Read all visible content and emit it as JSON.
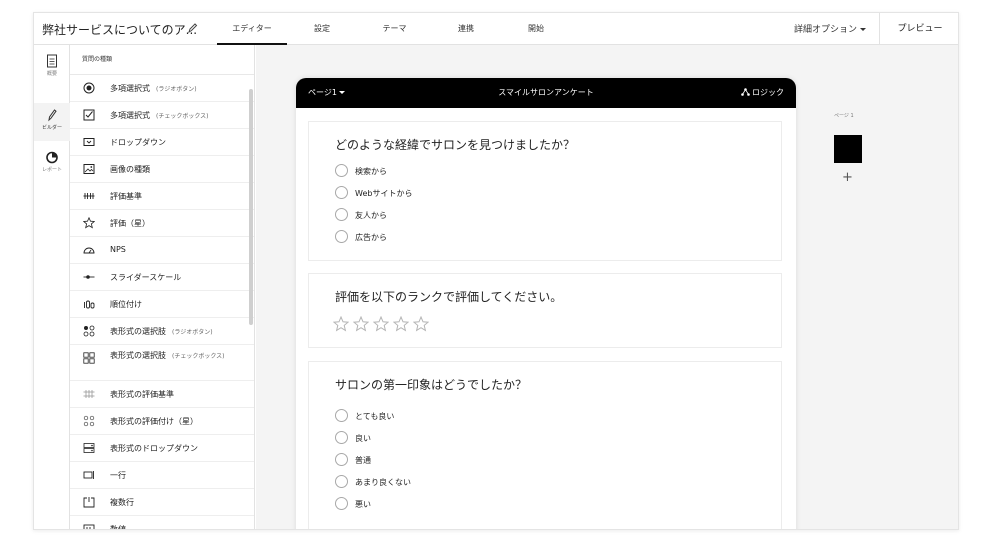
{
  "topbar": {
    "survey_title": "弊社サービスについてのア...",
    "tabs": [
      {
        "label": "エディター",
        "active": true
      },
      {
        "label": "設定",
        "active": false
      },
      {
        "label": "テーマ",
        "active": false
      },
      {
        "label": "連携",
        "active": false
      },
      {
        "label": "開始",
        "active": false
      }
    ],
    "advanced_options": "詳細オプション",
    "preview": "プレビュー"
  },
  "rail": [
    {
      "label": "概要",
      "icon": "document-icon"
    },
    {
      "label": "ビルダー",
      "icon": "pencil-icon",
      "active": true
    },
    {
      "label": "レポート",
      "icon": "pie-chart-icon"
    }
  ],
  "question_types": {
    "header": "質問の種類",
    "items": [
      {
        "label": "多項選択式",
        "sub": "(ラジオボタン)",
        "icon": "radio-button-icon"
      },
      {
        "label": "多項選択式",
        "sub": "(チェックボックス)",
        "icon": "checkbox-icon"
      },
      {
        "label": "ドロップダウン",
        "sub": "",
        "icon": "dropdown-icon"
      },
      {
        "label": "画像の種類",
        "sub": "",
        "icon": "image-icon"
      },
      {
        "label": "評価基準",
        "sub": "",
        "icon": "scale-icon"
      },
      {
        "label": "評価（星）",
        "sub": "",
        "icon": "star-icon"
      },
      {
        "label": "NPS",
        "sub": "",
        "icon": "gauge-icon"
      },
      {
        "label": "スライダースケール",
        "sub": "",
        "icon": "slider-icon"
      },
      {
        "label": "順位付け",
        "sub": "",
        "icon": "ranking-icon"
      },
      {
        "label": "表形式の選択肢",
        "sub": "(ラジオボタン)",
        "icon": "matrix-radio-icon"
      },
      {
        "label": "表形式の選択肢",
        "sub": "(チェックボックス)",
        "icon": "matrix-checkbox-icon"
      },
      {
        "label": "表形式の評価基準",
        "sub": "",
        "icon": "matrix-scale-icon"
      },
      {
        "label": "表形式の評価付け（星）",
        "sub": "",
        "icon": "matrix-star-icon"
      },
      {
        "label": "表形式のドロップダウン",
        "sub": "",
        "icon": "matrix-dropdown-icon"
      },
      {
        "label": "一行",
        "sub": "",
        "icon": "single-line-icon"
      },
      {
        "label": "複数行",
        "sub": "",
        "icon": "multi-line-icon"
      },
      {
        "label": "数値",
        "sub": "",
        "icon": "number-icon"
      }
    ]
  },
  "survey": {
    "page_label": "ページ1",
    "name": "スマイルサロンアンケート",
    "logic": "ロジック",
    "questions": [
      {
        "title": "どのような経緯でサロンを見つけましたか？",
        "options": [
          "検索から",
          "Webサイトから",
          "友人から",
          "広告から"
        ]
      },
      {
        "title": "評価を以下のランクで評価してください。",
        "stars": 5
      },
      {
        "title": "サロンの第一印象はどうでしたか？",
        "options": [
          "とても良い",
          "良い",
          "普通",
          "あまり良くない",
          "悪い"
        ]
      }
    ]
  },
  "pages_panel": {
    "label": "ページ 1",
    "add": "+"
  }
}
